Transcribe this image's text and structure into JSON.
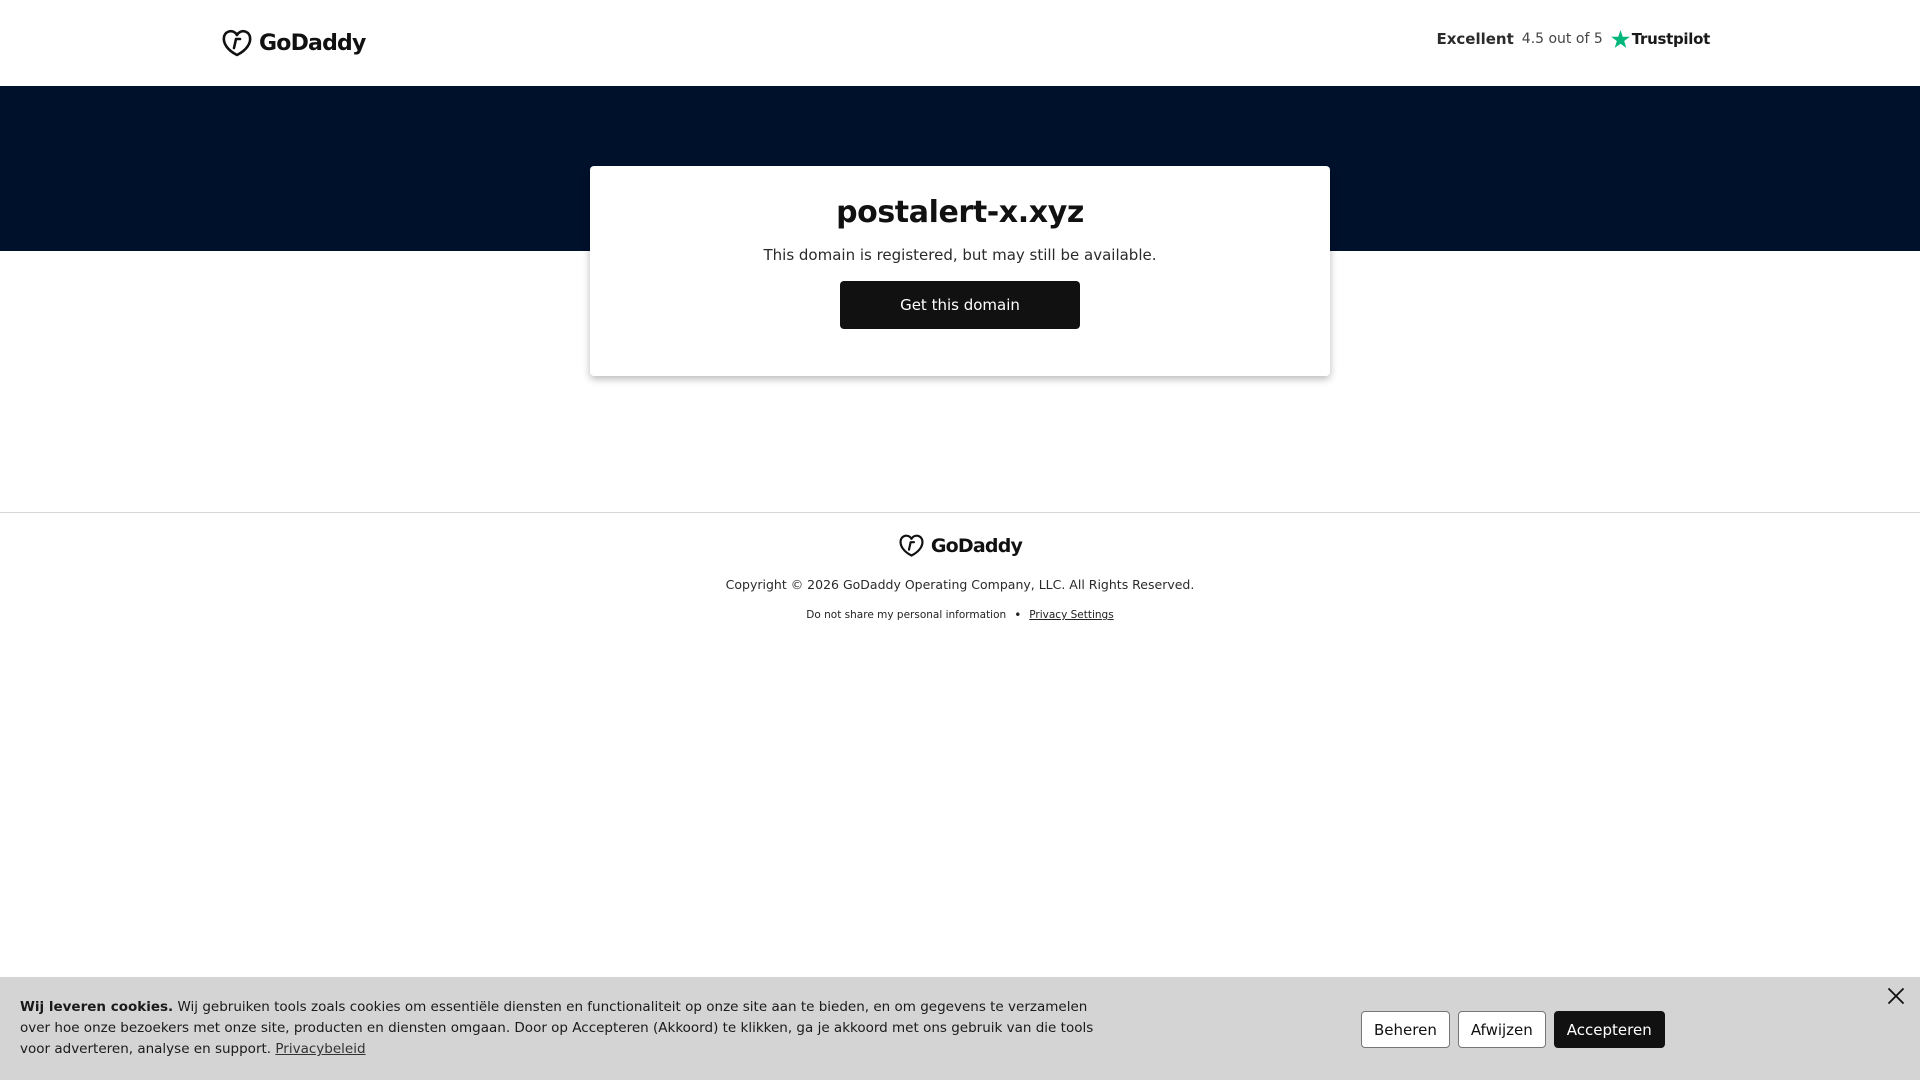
{
  "header": {
    "logo_text": "GoDaddy",
    "rating_label": "Excellent",
    "rating_score": "4.5 out of 5",
    "trustpilot_text": "Trustpilot"
  },
  "card": {
    "domain": "postalert-x.xyz",
    "subtitle": "This domain is registered, but may still be available.",
    "cta_label": "Get this domain"
  },
  "footer": {
    "logo_text": "GoDaddy",
    "copyright": "Copyright © 2026 GoDaddy Operating Company, LLC. All Rights Reserved.",
    "do_not_share": "Do not share my personal information",
    "separator": "•",
    "privacy_settings": "Privacy Settings"
  },
  "cookie_banner": {
    "title": "Wij leveren cookies.",
    "body": "Wij gebruiken tools zoals cookies om essentiële diensten en functionaliteit op onze site aan te bieden, en om gegevens te verzamelen over hoe onze bezoekers met onze site, producten en diensten omgaan. Door op Accepteren (Akkoord) te klikken, ga je akkoord met ons gebruik van die tools voor adverteren, analyse en support.",
    "policy_link": "Privacybeleid",
    "manage_label": "Beheren",
    "reject_label": "Afwijzen",
    "accept_label": "Accepteren"
  },
  "icons": {
    "logo": "godaddy-logo-icon",
    "star": "trustpilot-star-icon",
    "close": "close-icon"
  },
  "colors": {
    "hero_background": "#00112c",
    "button_dark": "#111111",
    "trustpilot_green": "#00b67a",
    "cookie_background": "#d4d4d4"
  }
}
